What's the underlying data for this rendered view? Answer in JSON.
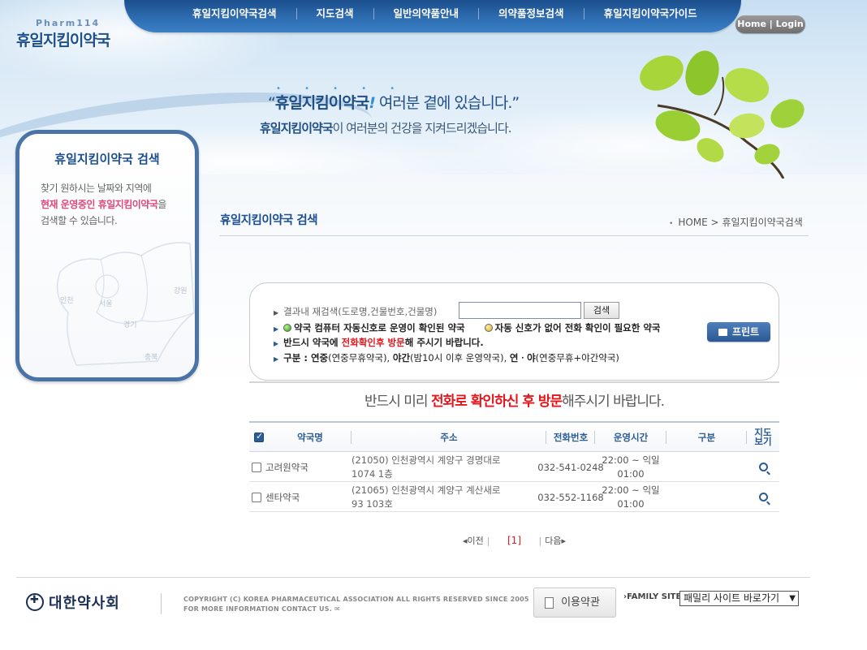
{
  "header": {
    "logo_sub": "Pharm114",
    "logo_main": "휴일지킴이약국",
    "nav": [
      "휴일지킴이약국검색",
      "지도검색",
      "일반의약품안내",
      "의약품정보검색",
      "휴일지킴이약국가이드"
    ],
    "home_login": "Home | Login",
    "slogan_quote_open": "“",
    "slogan_brand": "휴일지킴이약국",
    "slogan_excl": "!",
    "slogan_rest": " 여러분 곁에 있습니다.”",
    "slogan2_brand": "휴일지킴이약국",
    "slogan2_rest": "이 여러분의 건강을 지켜드리겠습니다."
  },
  "left_panel": {
    "title": "휴일지킴이약국 검색",
    "line1": "찾기 원하시는 날짜와 지역에",
    "line2_pink": "현재 운영중인 휴일지킴이약국",
    "line2_rest": "을",
    "line3": "검색할 수 있습니다.",
    "map_labels": [
      "인천",
      "서울",
      "경기",
      "강원",
      "충북"
    ]
  },
  "page": {
    "title": "휴일지킴이약국 검색",
    "breadcrumb_home": "HOME",
    "breadcrumb_sep": ">",
    "breadcrumb_current": "휴일지킴이약국검색"
  },
  "search": {
    "label": "결과내 재검색(도로명,건물번호,건물명)",
    "value": "",
    "button": "검색",
    "legend_green": "약국 컴퓨터 자동신호로 운영이 확인된 약국",
    "legend_yellow": "자동 신호가 없어 전화 확인이 필요한 약국",
    "notice_a": "반드시 약국에 ",
    "notice_red": "전화확인후 방문",
    "notice_b": "해 주시기 바랍니다.",
    "type_label": "구분 : ",
    "type_text_a": "연중",
    "type_text_b": "(연중무휴약국), ",
    "type_text_c": "야간",
    "type_text_d": "(밤10시 이후 운영약국), ",
    "type_text_e": "연ㆍ야",
    "type_text_f": "(연중무휴+야간약국)",
    "print_button": "프린트"
  },
  "notice": {
    "a": "반드시 미리 ",
    "red": "전화로 확인하신 후 방문",
    "b": "해주시기 바랍니다."
  },
  "table": {
    "headers": {
      "name": "약국명",
      "address": "주소",
      "phone": "전화번호",
      "hours": "운영시간",
      "type": "구분",
      "map": "지도\n보기"
    },
    "rows": [
      {
        "name": "고려원약국",
        "address_l1": "(21050) 인천광역시 계양구 경명대로",
        "address_l2": "1074 1층",
        "phone": "032-541-0248",
        "hours_l1": "22:00 ~ 익일",
        "hours_l2": "01:00",
        "type": ""
      },
      {
        "name": "센타약국",
        "address_l1": "(21065) 인천광역시 계양구 계산새로",
        "address_l2": "93 103호",
        "phone": "032-552-1168",
        "hours_l1": "22:00 ~ 익일",
        "hours_l2": "01:00",
        "type": ""
      }
    ]
  },
  "pager": {
    "prev": "이전",
    "current": "[1]",
    "next": "다음"
  },
  "footer": {
    "org_name": "대한약사회",
    "copyright_l1": "COPYRIGHT (C) KOREA PHARMACEUTICAL ASSOCIATION ALL RIGHTS RESERVED SINCE 2005",
    "copyright_l2": "FOR MORE INFORMATION CONTACT US.",
    "terms_button": "이용약관",
    "family_site_label": "FAMILY SITE",
    "family_site_selected": "패밀리 사이트 바로가기"
  },
  "colors": {
    "brand_blue": "#1b4f8e",
    "accent_red": "#e4161c",
    "accent_pink": "#e6447a"
  }
}
